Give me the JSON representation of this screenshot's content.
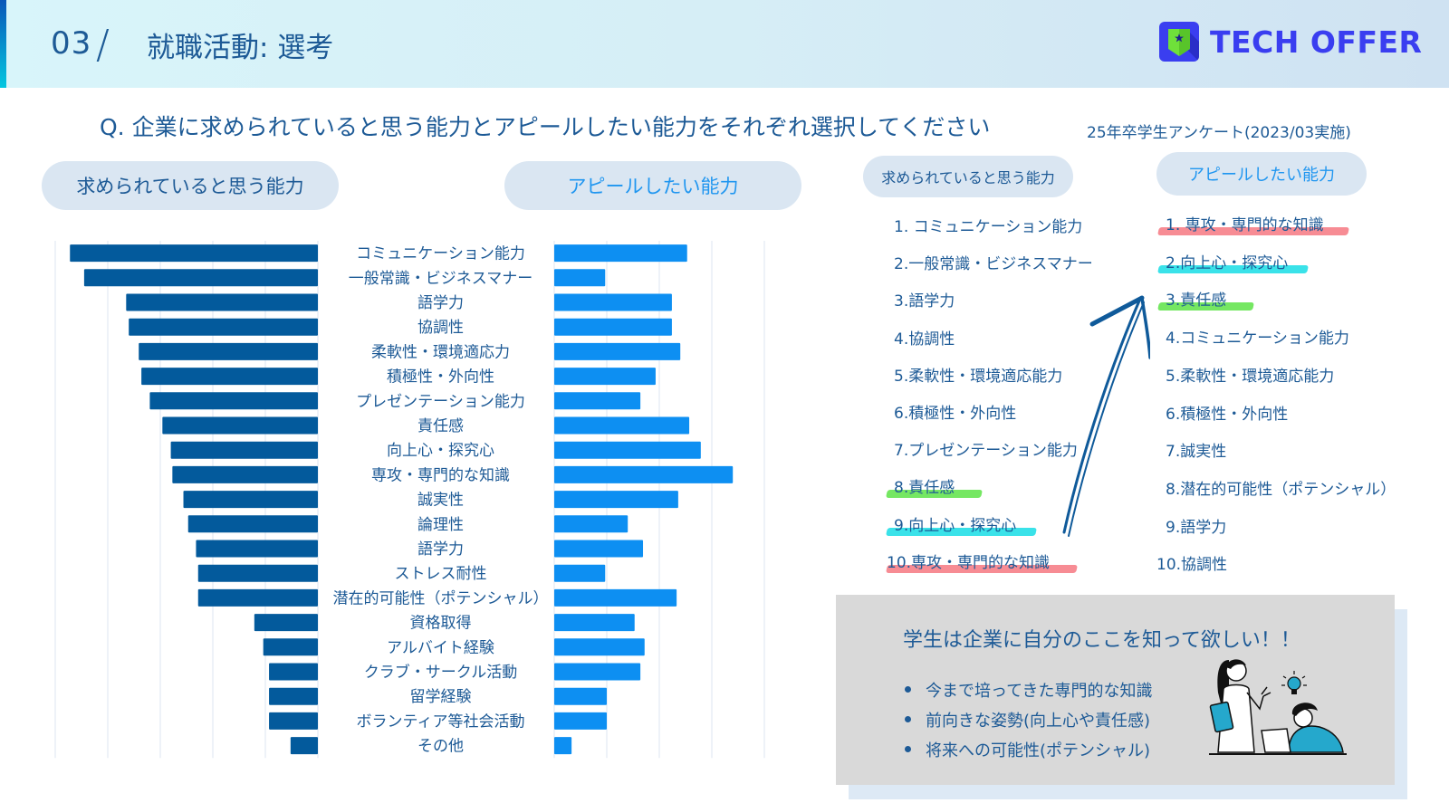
{
  "header": {
    "section_number": "03",
    "section_separator": "/",
    "title": "就職活動: 選考",
    "logo_text": "TECH OFFER",
    "colors": {
      "accent_gradient_top": "#0a56b8",
      "accent_gradient_bottom": "#04c7e0",
      "logo": "#3a3ef0",
      "logo_shield": "#6fe03a"
    }
  },
  "question": "Q. 企業に求められていると思う能力とアピールしたい能力をそれぞれ選択してください",
  "survey_note": "25年卒学生アンケート(2023/03実施)",
  "chart_pills": {
    "left": "求められていると思う能力",
    "right": "アピールしたい能力"
  },
  "chart_data": {
    "type": "bar",
    "orientation": "horizontal-butterfly",
    "title": "",
    "xlabel": "",
    "ylabel": "",
    "units": "relative (gridline intervals; no numeric tick labels shown)",
    "grid": true,
    "xlim_left": [
      0,
      5
    ],
    "xlim_right": [
      0,
      4
    ],
    "categories": [
      "コミュニケーション能力",
      "一般常識・ビジネスマナー",
      "語学力",
      "協調性",
      "柔軟性・環境適応力",
      "積極性・外向性",
      "プレゼンテーション能力",
      "責任感",
      "向上心・探究心",
      "専攻・専門的な知識",
      "誠実性",
      "論理性",
      "語学力",
      "ストレス耐性",
      "潜在的可能性（ポテンシャル）",
      "資格取得",
      "アルバイト経験",
      "クラブ・サークル活動",
      "留学経験",
      "ボランティア等社会活動",
      "その他"
    ],
    "series": [
      {
        "name": "求められていると思う能力",
        "color": "#035a9c",
        "side": "left",
        "values": [
          4.72,
          4.45,
          3.65,
          3.6,
          3.41,
          3.36,
          3.2,
          2.96,
          2.8,
          2.77,
          2.56,
          2.47,
          2.32,
          2.28,
          2.28,
          1.21,
          1.04,
          0.93,
          0.93,
          0.93,
          0.52
        ]
      },
      {
        "name": "アピールしたい能力",
        "color": "#0d8ff2",
        "side": "right",
        "values": [
          2.53,
          0.97,
          2.24,
          2.24,
          2.4,
          1.93,
          1.64,
          2.57,
          2.79,
          3.4,
          2.36,
          1.4,
          1.69,
          0.97,
          2.33,
          1.53,
          1.72,
          1.64,
          1.0,
          1.0,
          0.33
        ]
      }
    ]
  },
  "ranking": {
    "left_title": "求められていると思う能力",
    "right_title": "アピールしたい能力",
    "left": [
      {
        "label": "1. コミュニケーション能力",
        "highlight": null
      },
      {
        "label": "2.一般常識・ビジネスマナー",
        "highlight": null
      },
      {
        "label": "3.語学力",
        "highlight": null
      },
      {
        "label": "4.協調性",
        "highlight": null
      },
      {
        "label": "5.柔軟性・環境適応能力",
        "highlight": null
      },
      {
        "label": "6.積極性・外向性",
        "highlight": null
      },
      {
        "label": "7.プレゼンテーション能力",
        "highlight": null
      },
      {
        "label": "8.責任感",
        "highlight": "#6ee65a"
      },
      {
        "label": "9.向上心・探究心",
        "highlight": "#2fe0e8"
      },
      {
        "label": "10.専攻・専門的な知識",
        "highlight": "#f7868e"
      }
    ],
    "right": [
      {
        "label": "1. 専攻・専門的な知識",
        "highlight": "#f7868e"
      },
      {
        "label": "2.向上心・探究心",
        "highlight": "#2fe0e8"
      },
      {
        "label": "3.責任感",
        "highlight": "#6ee65a"
      },
      {
        "label": "4.コミュニケーション能力",
        "highlight": null
      },
      {
        "label": "5.柔軟性・環境適応能力",
        "highlight": null
      },
      {
        "label": "6.積極性・外向性",
        "highlight": null
      },
      {
        "label": "7.誠実性",
        "highlight": null
      },
      {
        "label": "8.潜在的可能性（ポテンシャル）",
        "highlight": null
      },
      {
        "label": "9.語学力",
        "highlight": null
      },
      {
        "label": "10.協調性",
        "highlight": null
      }
    ]
  },
  "callout": {
    "headline": "学生は企業に自分のここを知って欲しい！！",
    "bullets": [
      "今まで培ってきた専門的な知識",
      "前向きな姿勢(向上心や責任感)",
      "将来への可能性(ポテンシャル)"
    ],
    "illustration": "people-with-lightbulb-illustration"
  }
}
